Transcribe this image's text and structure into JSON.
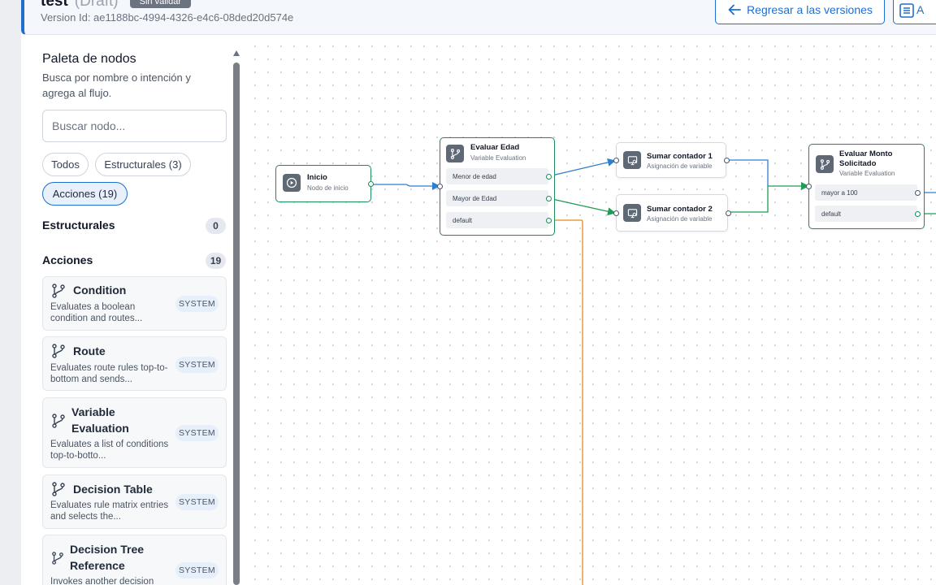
{
  "header": {
    "title": "test",
    "status": "(Draft)",
    "validation_badge": "Sin validar",
    "version_id": "Version Id: ae1188bc-4994-4326-e4c6-08ded20d574e",
    "back_button": "Regresar a las versiones",
    "more_button": "A"
  },
  "palette": {
    "title": "Paleta de nodos",
    "subtitle": "Busca por nombre o intención y agrega al flujo.",
    "search_placeholder": "Buscar nodo...",
    "filters": [
      "Todos",
      "Estructurales (3)",
      "Acciones (19)"
    ],
    "active_filter": "Acciones (19)",
    "sections": [
      {
        "label": "Estructurales",
        "count": "0"
      },
      {
        "label": "Acciones",
        "count": "19"
      }
    ],
    "items": [
      {
        "title": "Condition",
        "desc": "Evaluates a boolean condition and routes...",
        "badge": "SYSTEM",
        "icon": "branch-icon"
      },
      {
        "title": "Route",
        "desc": "Evaluates route rules top-to-bottom and sends...",
        "badge": "SYSTEM",
        "icon": "branch-icon"
      },
      {
        "title": "Variable Evaluation",
        "desc": "Evaluates a list of conditions top-to-botto...",
        "badge": "SYSTEM",
        "icon": "branch-icon"
      },
      {
        "title": "Decision Table",
        "desc": "Evaluates rule matrix entries and selects the...",
        "badge": "SYSTEM",
        "icon": "branch-icon"
      },
      {
        "title": "Decision Tree Reference",
        "desc": "Invokes another decision",
        "badge": "SYSTEM",
        "icon": "branch-icon"
      }
    ]
  },
  "flow": {
    "nodes": {
      "inicio": {
        "title": "Inicio",
        "subtitle": "Nodo de inicio",
        "icon": "play-icon"
      },
      "evaluar_edad": {
        "title": "Evaluar Edad",
        "subtitle": "Variable Evaluation",
        "icon": "branch-icon",
        "rows": [
          "Menor de edad",
          "Mayor de Edad",
          "default"
        ]
      },
      "sumar1": {
        "title": "Sumar contador 1",
        "subtitle": "Asignación de variable",
        "icon": "monitor-icon"
      },
      "sumar2": {
        "title": "Sumar contador 2",
        "subtitle": "Asignación de variable",
        "icon": "monitor-icon"
      },
      "evaluar_monto": {
        "title": "Evaluar Monto Solicitado",
        "subtitle": "Variable Evaluation",
        "icon": "branch-icon",
        "rows": [
          "mayor a 100",
          "default"
        ]
      }
    },
    "edge_colors": {
      "green": "#1f9d55",
      "blue": "#2f7fd1",
      "orange": "#e08a1e"
    }
  },
  "colors": {
    "accent": "#1e6fd1",
    "node_border": "#1f8a5b"
  }
}
